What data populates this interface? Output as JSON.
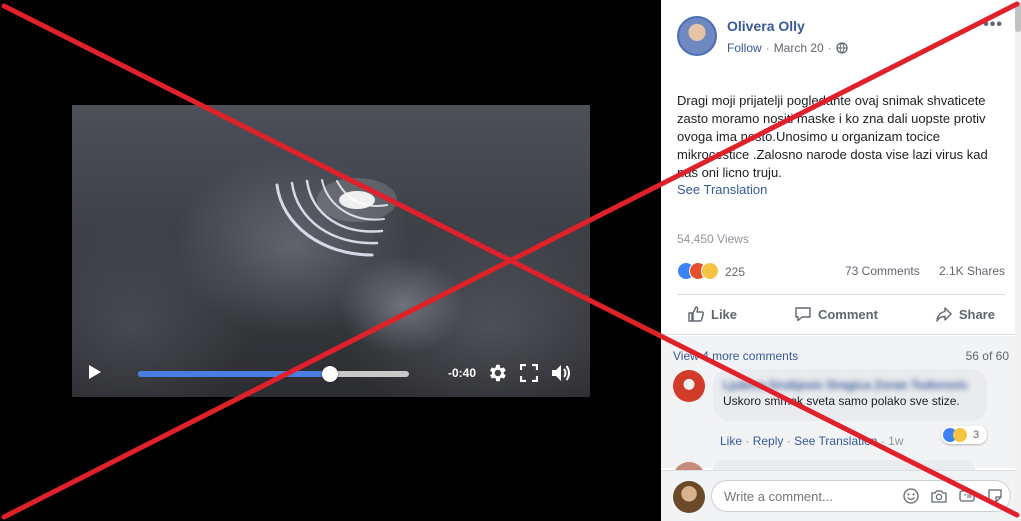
{
  "video": {
    "time_remaining": "-0:40",
    "progress": 0.71
  },
  "post": {
    "author": "Olivera Olly",
    "follow": "Follow",
    "date": "March 20",
    "text": "Dragi moji prijatelji pogledahte ovaj snimak shvaticete zasto moramo nositi maske i ko zna dali uopste protiv ovoga ima nesto.Unosimo u organizam tocice mikrocestice .Zalosno narode dosta vise lazi virus kad nas oni licno truju.",
    "see_translation": "See Translation",
    "views": "54,450 Views",
    "reaction_count": "225",
    "comments_count": "73 Comments",
    "shares_count": "2.1K Shares"
  },
  "actions": {
    "like": "Like",
    "comment": "Comment",
    "share": "Share"
  },
  "comments": {
    "view_more": "View 4 more comments",
    "page": "56 of 60",
    "first": {
      "author": "Ljubica Grubjesic Dragica Zoran Todorovic",
      "text": "Uskoro smmak sveta samo polako sve stize.",
      "like": "Like",
      "reply": "Reply",
      "see_translation": "See Translation",
      "age": "1w",
      "reaction_count": "3"
    }
  },
  "composer": {
    "placeholder": "Write a comment..."
  },
  "colors": {
    "link_blue": "#385898",
    "overlay_red": "#e0202a",
    "scrub_blue": "#4a7de2"
  }
}
